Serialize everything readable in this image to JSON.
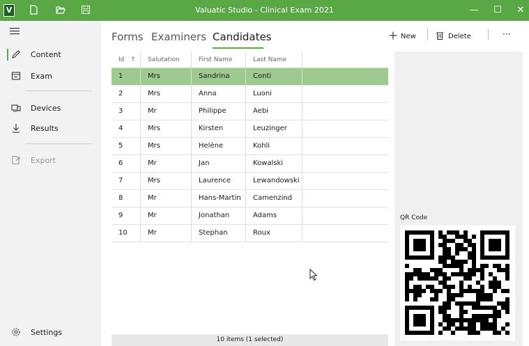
{
  "window": {
    "title": "Valuatic Studio - Clinical Exam 2021",
    "logo_letter": "V",
    "minimize": "—",
    "maximize": "☐",
    "close": "✕"
  },
  "sidebar": {
    "items": [
      {
        "label": "Content",
        "icon": "pencil-icon",
        "active": true
      },
      {
        "label": "Exam",
        "icon": "exam-icon"
      },
      {
        "label": "Devices",
        "icon": "devices-icon"
      },
      {
        "label": "Results",
        "icon": "download-icon"
      },
      {
        "label": "Export",
        "icon": "export-icon",
        "disabled": true
      }
    ],
    "settings_label": "Settings"
  },
  "tabs": [
    {
      "label": "Forms"
    },
    {
      "label": "Examiners"
    },
    {
      "label": "Candidates",
      "active": true
    }
  ],
  "commands": {
    "new_label": "New",
    "delete_label": "Delete",
    "more_label": "···"
  },
  "table": {
    "columns": [
      "Id",
      "Salutation",
      "First Name",
      "Last Name"
    ],
    "sort_indicator": "↑",
    "rows": [
      {
        "id": "1",
        "salutation": "Mrs",
        "first": "Sandrina",
        "last": "Conti",
        "selected": true
      },
      {
        "id": "2",
        "salutation": "Mrs",
        "first": "Anna",
        "last": "Luoni"
      },
      {
        "id": "3",
        "salutation": "Mr",
        "first": "Philippe",
        "last": "Aebi"
      },
      {
        "id": "4",
        "salutation": "Mrs",
        "first": "Kirsten",
        "last": "Leuzinger"
      },
      {
        "id": "5",
        "salutation": "Mrs",
        "first": "Helène",
        "last": "Kohli"
      },
      {
        "id": "6",
        "salutation": "Mr",
        "first": "Jan",
        "last": "Kowalski"
      },
      {
        "id": "7",
        "salutation": "Mrs",
        "first": "Laurence",
        "last": "Lewandowski"
      },
      {
        "id": "8",
        "salutation": "Mr",
        "first": "Hans-Martin",
        "last": "Camenzind"
      },
      {
        "id": "9",
        "salutation": "Mr",
        "first": "Jonathan",
        "last": "Adams"
      },
      {
        "id": "10",
        "salutation": "Mr",
        "first": "Stephan",
        "last": "Roux"
      }
    ],
    "status": "10 items (1 selected)"
  },
  "details": {
    "qr_label": "QR Code",
    "qr_icon": "qr-code-icon"
  },
  "colors": {
    "accent": "#5aa845",
    "selected_row": "#9ec98f"
  }
}
